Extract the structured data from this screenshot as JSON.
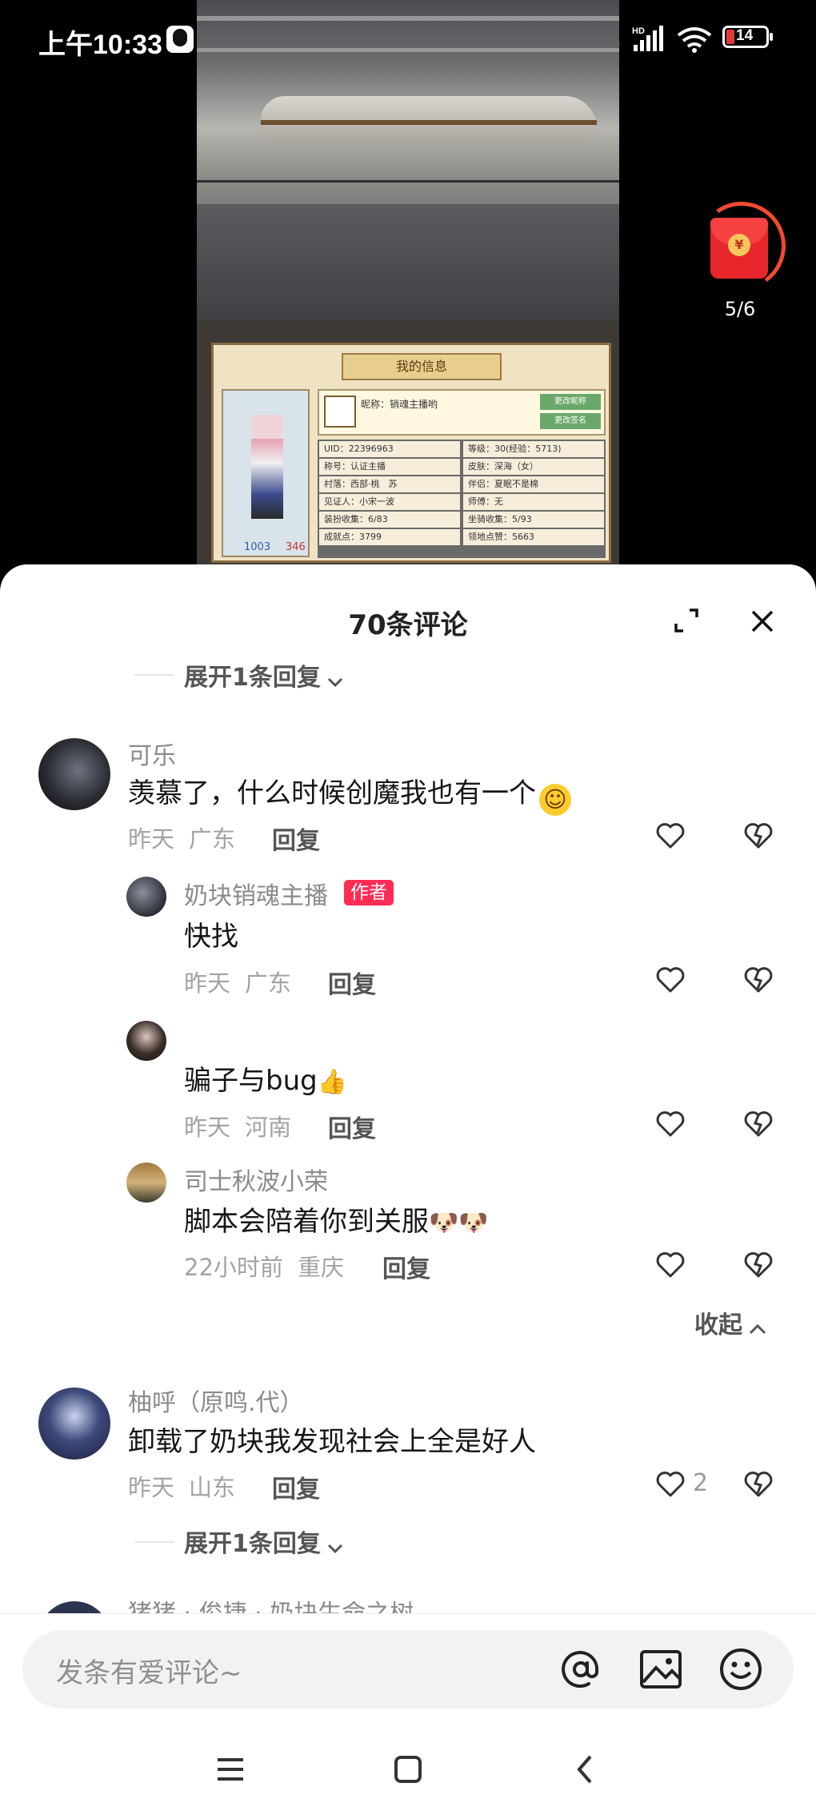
{
  "status_bar": {
    "time": "上午10:33",
    "battery": "14",
    "more": "···"
  },
  "video": {
    "game_title": "我的信息",
    "nickname": "昵称：销魂主播哟",
    "btn_change_name": "更改昵称",
    "btn_change_sign": "更改签名",
    "uid": "UID：22396963",
    "level": "等级：30(经验：5713)",
    "title": "称号：认证主播",
    "skin": "皮肤：深海（女）",
    "village": "村落：西部·桃　苏",
    "partner": "伴侣：夏眠不是棉",
    "witness": "见证人：小宋一波",
    "master": "师傅：无",
    "outfit": "装扮收集：6/83",
    "mount": "坐骑收集：5/93",
    "achieve": "成就点：3799",
    "territory": "领地点赞：5663",
    "stat_left": "1003",
    "stat_right": "346"
  },
  "red_envelope": {
    "count": "5/6",
    "coin": "¥"
  },
  "comments_sheet": {
    "title": "70条评论",
    "expand_reply_top": "展开1条回复",
    "comments": [
      {
        "user": "可乐",
        "text": "羡慕了，什么时候创魔我也有一个",
        "emoji": "☺",
        "time": "昨天",
        "loc": "广东",
        "reply": "回复"
      },
      {
        "user": "柚呼（原鸣.代）",
        "text": "卸载了奶块我发现社会上全是好人",
        "time": "昨天",
        "loc": "山东",
        "reply": "回复",
        "likes": "2"
      }
    ],
    "replies": [
      {
        "user": "奶块销魂主播",
        "badge": "作者",
        "text": "快找",
        "time": "昨天",
        "loc": "广东",
        "reply": "回复"
      },
      {
        "user": "",
        "text": "骗子与bug",
        "emoji": "👍",
        "time": "昨天",
        "loc": "河南",
        "reply": "回复"
      },
      {
        "user": "司士秋波小荣",
        "text": "脚本会陪着你到关服",
        "emoji": "🐶🐶",
        "time": "22小时前",
        "loc": "重庆",
        "reply": "回复"
      }
    ],
    "collapse": "收起",
    "expand_reply_bottom": "展开1条回复",
    "partial_next_user": "猪猪 · 俊捷 · 奶块生命之树"
  },
  "input": {
    "placeholder": "发条有爱评论~"
  },
  "colors": {
    "author_badge": "#fe2c55",
    "envelope": "#e8262b"
  }
}
